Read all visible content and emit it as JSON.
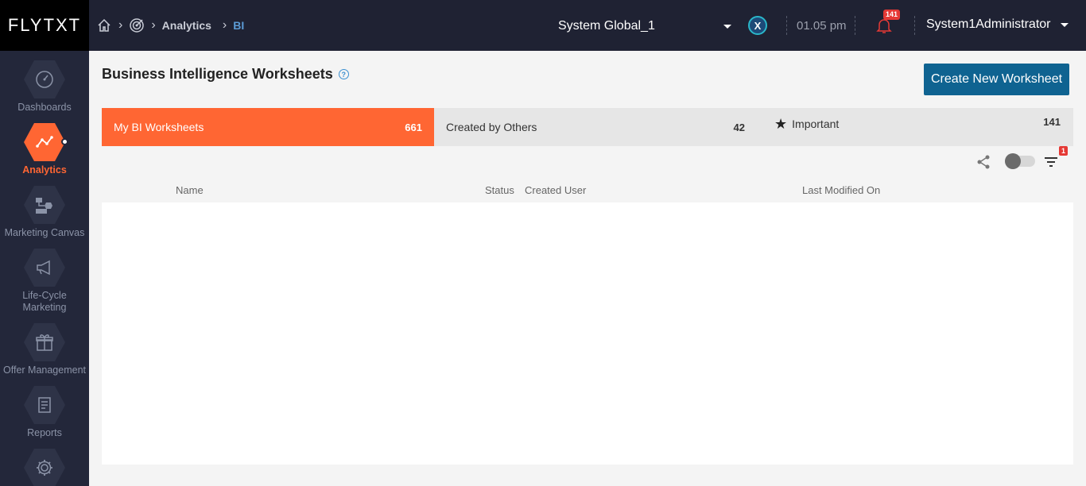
{
  "topbar": {
    "logo": "FLYTXT",
    "breadcrumb": [
      "Analytics",
      "BI"
    ],
    "system_select": "System Global_1",
    "time": "01.05 pm",
    "notification_count": "141",
    "user": "System1Administrator",
    "x_badge": "X"
  },
  "sidebar": {
    "items": [
      {
        "label": "Dashboards",
        "icon": "speedometer-icon"
      },
      {
        "label": "Analytics",
        "icon": "line-graph-icon",
        "active": true
      },
      {
        "label": "Marketing Canvas",
        "icon": "flow-icon"
      },
      {
        "label": "Life-Cycle Marketing",
        "icon": "megaphone-icon"
      },
      {
        "label": "Offer Management",
        "icon": "gift-icon"
      },
      {
        "label": "Reports",
        "icon": "document-icon"
      },
      {
        "label": "",
        "icon": "gear-icon"
      }
    ]
  },
  "main": {
    "title": "Business Intelligence Worksheets",
    "create_button": "Create New Worksheet",
    "tabs": [
      {
        "label": "My BI Worksheets",
        "count": "661"
      },
      {
        "label": "Created by Others",
        "count": "42"
      },
      {
        "label": "Important",
        "count": "141"
      }
    ],
    "filter_count": "1",
    "columns": [
      "Name",
      "Status",
      "Created User",
      "Last Modified On"
    ]
  },
  "colors": {
    "accent": "#ff6633",
    "topbar": "#1f2233",
    "sidebar": "#23273a",
    "primary_button": "#0f6391"
  }
}
